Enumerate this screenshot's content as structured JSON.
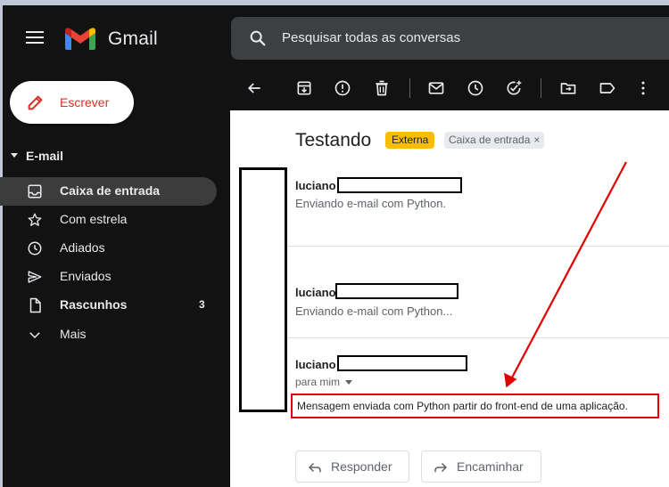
{
  "header": {
    "app_name": "Gmail",
    "search_placeholder": "Pesquisar todas as conversas"
  },
  "sidebar": {
    "compose_label": "Escrever",
    "section_label": "E-mail",
    "items": [
      {
        "label": "Caixa de entrada",
        "icon": "inbox-icon",
        "active": true,
        "bold": true
      },
      {
        "label": "Com estrela",
        "icon": "star-icon"
      },
      {
        "label": "Adiados",
        "icon": "clock-icon"
      },
      {
        "label": "Enviados",
        "icon": "send-icon"
      },
      {
        "label": "Rascunhos",
        "icon": "draft-icon",
        "bold": true,
        "count": "3"
      },
      {
        "label": "Mais",
        "icon": "chevron-down-icon"
      }
    ]
  },
  "toolbar": {
    "icons": [
      "back-arrow-icon",
      "archive-icon",
      "report-spam-icon",
      "delete-icon",
      "mark-unread-icon",
      "snooze-icon",
      "add-task-icon",
      "move-to-icon",
      "label-icon",
      "more-vert-icon"
    ]
  },
  "thread": {
    "subject": "Testando",
    "badge_external": "Externa",
    "badge_inbox": "Caixa de entrada",
    "badge_close": "×",
    "messages": [
      {
        "sender": "luciano",
        "snippet": "Enviando e-mail com Python."
      },
      {
        "sender": "luciano",
        "snippet": "Enviando e-mail com Python..."
      },
      {
        "sender": "luciano",
        "to": "para mim",
        "body": "Mensagem enviada com Python partir do front-end de uma aplicação."
      }
    ],
    "reply_label": "Responder",
    "forward_label": "Encaminhar"
  },
  "colors": {
    "compose_text": "#d93025",
    "badge_external": "#fbbc04",
    "highlight_box": "#e00000",
    "annotation_arrow": "#e00000"
  }
}
